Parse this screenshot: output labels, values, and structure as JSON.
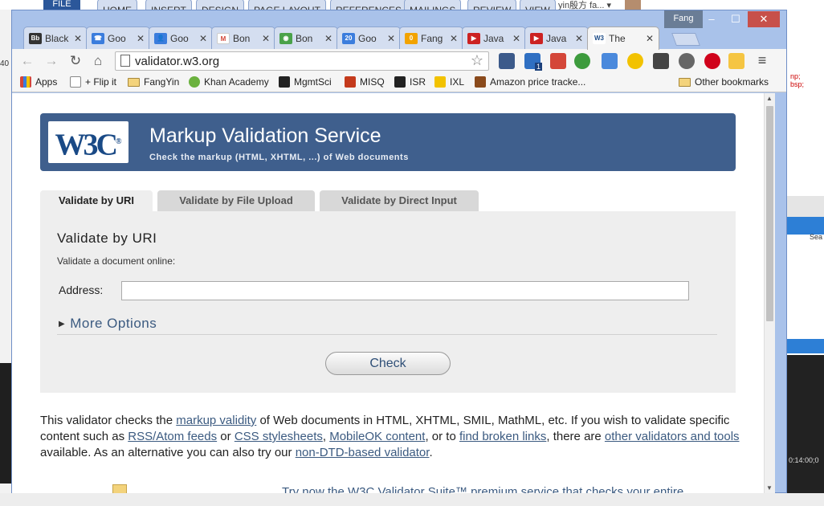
{
  "word": {
    "file": "FILE",
    "tabs": [
      "HOME",
      "INSERT",
      "DESIGN",
      "PAGE LAYOUT",
      "REFERENCES",
      "MAILINGS",
      "REVIEW",
      "VIEW"
    ],
    "user": "yin殷方 fa...",
    "arrow": "▾"
  },
  "window": {
    "profile": "Fang",
    "minimize": "–",
    "maximize": "☐",
    "close": "✕"
  },
  "tabs": [
    {
      "label": "Black",
      "icon_text": "Bb",
      "icon_color": "#333333"
    },
    {
      "label": "Goo",
      "icon_text": "☎",
      "icon_color": "#3b7ddd"
    },
    {
      "label": "Goo",
      "icon_text": "👤",
      "icon_color": "#3b7ddd"
    },
    {
      "label": "Bon",
      "icon_text": "M",
      "icon_color": "#d44638"
    },
    {
      "label": "Bon",
      "icon_text": "◉",
      "icon_color": "#4aa24a"
    },
    {
      "label": "Goo",
      "icon_text": "20",
      "icon_color": "#3b7ddd"
    },
    {
      "label": "Fang",
      "icon_text": "0",
      "icon_color": "#f2a300"
    },
    {
      "label": "Java",
      "icon_text": "▶",
      "icon_color": "#cc2222"
    },
    {
      "label": "Java",
      "icon_text": "▶",
      "icon_color": "#cc2222"
    },
    {
      "label": "The",
      "icon_text": "W3",
      "icon_color": "#1a4a86",
      "active": true
    }
  ],
  "tab_close": "✕",
  "toolbar": {
    "back": "←",
    "forward": "→",
    "reload": "↻",
    "home": "⌂",
    "url": "validator.w3.org",
    "star": "☆",
    "menu": "≡",
    "extension_count": "1"
  },
  "bookmarks": {
    "items": [
      "Apps",
      "+ Flip it",
      "FangYin",
      "Khan Academy",
      "MgmtSci",
      "MISQ",
      "ISR",
      "IXL",
      "Amazon price tracke..."
    ],
    "other": "Other bookmarks"
  },
  "page": {
    "logo": "W3C",
    "logo_reg": "®",
    "title": "Markup Validation Service",
    "subtitle": "Check the markup (HTML, XHTML, ...) of Web documents",
    "tabs": [
      "Validate by URI",
      "Validate by File Upload",
      "Validate by Direct Input"
    ],
    "panel_title": "Validate by URI",
    "panel_desc": "Validate a document online:",
    "address_label": "Address:",
    "address_value": "",
    "more_options": "More Options",
    "check": "Check",
    "intro": {
      "p1": "This validator checks the ",
      "l1": "markup validity",
      "p2": " of Web documents in HTML, XHTML, SMIL, MathML, etc. If you wish to validate specific content such as ",
      "l2": "RSS/Atom feeds",
      "p3": " or ",
      "l3": "CSS stylesheets",
      "p4": ", ",
      "l4": "MobileOK content",
      "p5": ", or to ",
      "l5": "find broken links",
      "p6": ", there are ",
      "l6": "other validators and tools",
      "p7": " available. As an alternative you can also try our ",
      "l7": "non-DTD-based validator",
      "p8": "."
    },
    "suite_text": "Try now the W3C Validator Suite™ premium service that checks your entire"
  },
  "background": {
    "left_mark": "40",
    "right_code": "np;\nbsp;",
    "right_search": "Sea",
    "right_time": "0:14:00;0"
  },
  "colors": {
    "banner": "#3f5f8d",
    "link": "#3b5a80",
    "chrome_frame": "#a9c2ea"
  }
}
